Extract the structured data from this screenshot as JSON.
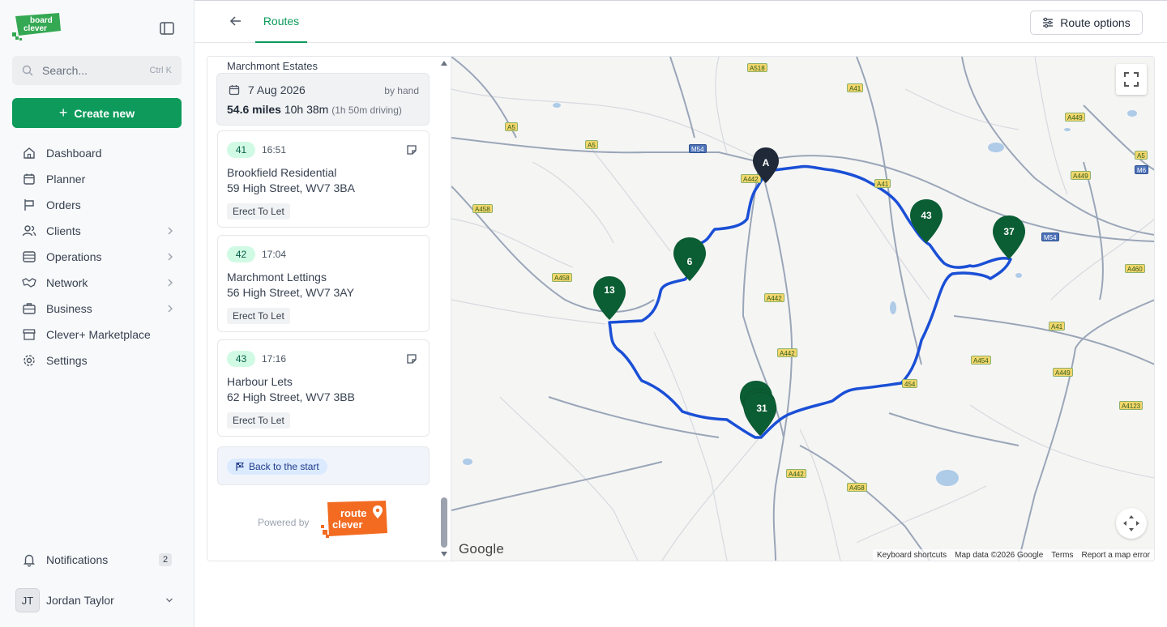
{
  "sidebar": {
    "search_placeholder": "Search...",
    "search_shortcut": "Ctrl K",
    "create_label": "Create new",
    "nav": [
      {
        "label": "Dashboard"
      },
      {
        "label": "Planner"
      },
      {
        "label": "Orders"
      },
      {
        "label": "Clients"
      },
      {
        "label": "Operations"
      },
      {
        "label": "Network"
      },
      {
        "label": "Business"
      },
      {
        "label": "Clever+ Marketplace"
      },
      {
        "label": "Settings"
      }
    ],
    "notifications_label": "Notifications",
    "notifications_count": "2",
    "user_initials": "JT",
    "user_name": "Jordan Taylor"
  },
  "topbar": {
    "tab_label": "Routes",
    "route_options_label": "Route options"
  },
  "route": {
    "cut_off_name": "Marchmont Estates",
    "date": "7 Aug 2026",
    "method": "by hand",
    "distance": "54.6 miles",
    "duration": "10h 38m",
    "driving": "(1h 50m driving)",
    "stops": [
      {
        "number": "41",
        "time": "16:51",
        "name": "Brookfield Residential",
        "address": "59 High Street, WV7 3BA",
        "tag": "Erect To Let"
      },
      {
        "number": "42",
        "time": "17:04",
        "name": "Marchmont Lettings",
        "address": "56 High Street, WV7 3AY",
        "tag": "Erect To Let"
      },
      {
        "number": "43",
        "time": "17:16",
        "name": "Harbour Lets",
        "address": "62 High Street, WV7 3BB",
        "tag": "Erect To Let"
      }
    ],
    "back_to_start_label": "Back to the start",
    "powered_by": "Powered by"
  },
  "brand": {
    "board_logo_text": [
      "board",
      "clever"
    ],
    "route_logo_text": [
      "route",
      "clever"
    ],
    "green": "#0d9a5b",
    "orange": "#f26b21",
    "route_blue": "#1a4fd6",
    "pin_green": "#0b5d33",
    "pin_navy": "#1f2937"
  },
  "map": {
    "google_label": "Google",
    "attribution": {
      "shortcuts": "Keyboard shortcuts",
      "data": "Map data ©2026 Google",
      "terms": "Terms",
      "report": "Report a map error"
    },
    "pins": [
      {
        "label": "A"
      },
      {
        "label": "43"
      },
      {
        "label": "37"
      },
      {
        "label": "6"
      },
      {
        "label": "13"
      },
      {
        "label": "31"
      }
    ],
    "road_labels": [
      {
        "text": "A518",
        "kind": "a"
      },
      {
        "text": "A41",
        "kind": "a"
      },
      {
        "text": "A5",
        "kind": "a"
      },
      {
        "text": "A5",
        "kind": "a"
      },
      {
        "text": "M54",
        "kind": "m"
      },
      {
        "text": "A442",
        "kind": "a"
      },
      {
        "text": "A449",
        "kind": "a"
      },
      {
        "text": "A5",
        "kind": "a"
      },
      {
        "text": "A449",
        "kind": "a"
      },
      {
        "text": "M6",
        "kind": "m"
      },
      {
        "text": "A41",
        "kind": "a"
      },
      {
        "text": "A458",
        "kind": "a"
      },
      {
        "text": "M54",
        "kind": "m"
      },
      {
        "text": "A460",
        "kind": "a"
      },
      {
        "text": "A458",
        "kind": "a"
      },
      {
        "text": "A442",
        "kind": "a"
      },
      {
        "text": "A41",
        "kind": "a"
      },
      {
        "text": "A442",
        "kind": "a"
      },
      {
        "text": "A454",
        "kind": "a"
      },
      {
        "text": "A449",
        "kind": "a"
      },
      {
        "text": "454",
        "kind": "a"
      },
      {
        "text": "A4123",
        "kind": "a"
      },
      {
        "text": "A442",
        "kind": "a"
      },
      {
        "text": "A458",
        "kind": "a"
      }
    ]
  }
}
